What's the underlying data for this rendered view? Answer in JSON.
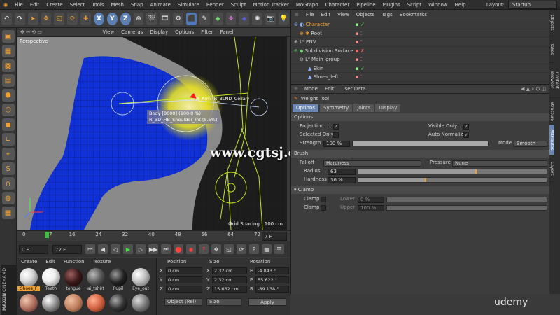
{
  "menubar": {
    "items": [
      "File",
      "Edit",
      "Create",
      "Select",
      "Tools",
      "Mesh",
      "Snap",
      "Animate",
      "Simulate",
      "Render",
      "Sculpt",
      "Motion Tracker",
      "MoGraph",
      "Character",
      "Pipeline",
      "Plugins",
      "Script",
      "Window",
      "Help"
    ],
    "layout_label": "Layout:",
    "layout_value": "Startup"
  },
  "toolbar": {
    "x_label": "X",
    "y_label": "Y",
    "z_label": "Z"
  },
  "viewport": {
    "menu": [
      "View",
      "Cameras",
      "Display",
      "Options",
      "Filter",
      "Panel"
    ],
    "label": "Perspective",
    "tooltip_joint": "R_Arm (R_BLND_Collar)",
    "tooltip_line1": "Body [8000] (100.0 %)",
    "tooltip_line2": "R_BD_HB_Shoulder_Int (5.5%)",
    "grid_spacing": "Grid Spacing : 100 cm"
  },
  "timeline": {
    "ticks": [
      "0",
      "8",
      "16",
      "24",
      "32",
      "40",
      "48",
      "56",
      "64",
      "72"
    ],
    "current_frame_marker": "7",
    "end_field": "7 F"
  },
  "transport": {
    "start_field": "0 F",
    "end_field": "72 F"
  },
  "materials": {
    "menu": [
      "Create",
      "Edit",
      "Function",
      "Texture"
    ],
    "items": [
      {
        "name": "Shoes_F",
        "color": "#d9d9d9"
      },
      {
        "name": "Teeth",
        "color": "#eeeeee"
      },
      {
        "name": "tongue",
        "color": "#3a1a1a"
      },
      {
        "name": "ai_tshirt",
        "color": "#555555"
      },
      {
        "name": "Pupil",
        "color": "#222222"
      },
      {
        "name": "Eye_out",
        "color": "#c8c8c8"
      }
    ],
    "brand_line1": "MAXON",
    "brand_line2": "CINEMA 4D"
  },
  "coords": {
    "headers": [
      "Position",
      "Size",
      "Rotation"
    ],
    "rows": [
      {
        "axis": "X",
        "pos": "0 cm",
        "size": "2.32 cm",
        "rot_axis": "H",
        "rot": "-4.843 °"
      },
      {
        "axis": "Y",
        "pos": "0 cm",
        "size": "2.32 cm",
        "rot_axis": "P",
        "rot": "55.622 °"
      },
      {
        "axis": "Z",
        "pos": "0 cm",
        "size": "15.662 cm",
        "rot_axis": "B",
        "rot": "-89.138 °"
      }
    ],
    "mode_dropdown": "Object (Rel)",
    "size_dropdown": "Size",
    "apply_label": "Apply"
  },
  "object_manager": {
    "menu": [
      "File",
      "Edit",
      "View",
      "Objects",
      "Tags",
      "Bookmarks"
    ],
    "rows": [
      {
        "name": "Character",
        "indent": 0,
        "color": "#f0a030"
      },
      {
        "name": "Root",
        "indent": 1,
        "color": "#d6d6d6"
      },
      {
        "name": "ENV",
        "indent": 0,
        "color": "#d6d6d6"
      },
      {
        "name": "Subdivision Surface",
        "indent": 0,
        "color": "#d6d6d6"
      },
      {
        "name": "Main_group",
        "indent": 1,
        "color": "#d6d6d6"
      },
      {
        "name": "Skin",
        "indent": 2,
        "color": "#d6d6d6"
      },
      {
        "name": "Shoes_left",
        "indent": 2,
        "color": "#d6d6d6"
      }
    ]
  },
  "attributes": {
    "menu": [
      "Mode",
      "Edit",
      "User Data"
    ],
    "tool_name": "Weight Tool",
    "tabs": [
      "Options",
      "Symmetry",
      "Joints",
      "Display"
    ],
    "section_options": "Options",
    "projection_label": "Projection . . .",
    "selected_only_label": "Selected Only",
    "strength_label": "Strength",
    "strength_value": "100 %",
    "strength_fill": 1.0,
    "visible_only_label": "Visible Only. . . .",
    "auto_normalize_label": "Auto Normalize",
    "mode_label": "Mode",
    "mode_value": "Smooth",
    "section_brush": "Brush",
    "falloff_label": "Falloff",
    "falloff_value": "Hardness",
    "pressure_label": "Pressure",
    "pressure_value": "None",
    "radius_label": "Radius . .",
    "radius_value": "63",
    "radius_fill": 0.63,
    "hardness_label": "Hardness",
    "hardness_value": "36 %",
    "hardness_fill": 0.36,
    "section_clamp": "Clamp",
    "clamp_label": "Clamp",
    "lower_label": "Lower",
    "lower_value": "0 %",
    "upper_label": "Upper",
    "upper_value": "100 %"
  },
  "sidetabs": [
    "Objects",
    "Takes",
    "Content Browser",
    "Structure",
    "Attributes",
    "Layers"
  ],
  "watermark": "www.cgtsj.com",
  "udemy": "udemy"
}
